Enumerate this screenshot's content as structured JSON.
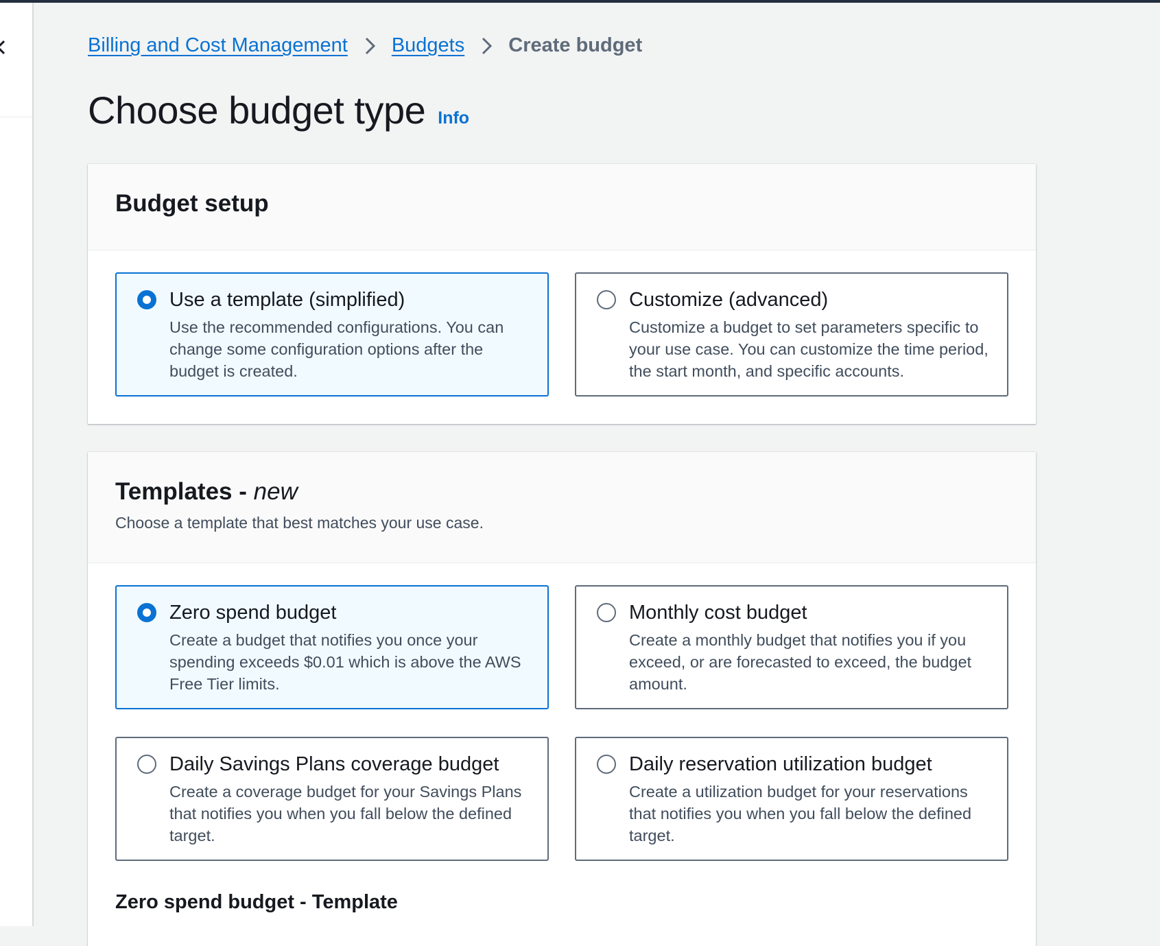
{
  "breadcrumb": {
    "items": [
      "Billing and Cost Management",
      "Budgets"
    ],
    "current": "Create budget"
  },
  "page": {
    "title": "Choose budget type",
    "info_label": "Info"
  },
  "budget_setup": {
    "title": "Budget setup",
    "options": [
      {
        "label": "Use a template (simplified)",
        "description": "Use the recommended configurations. You can change some configuration options after the budget is created.",
        "selected": true
      },
      {
        "label": "Customize (advanced)",
        "description": "Customize a budget to set parameters specific to your use case. You can customize the time period, the start month, and specific accounts.",
        "selected": false
      }
    ]
  },
  "templates": {
    "title": "Templates - ",
    "title_em": "new",
    "description": "Choose a template that best matches your use case.",
    "options": [
      {
        "label": "Zero spend budget",
        "description": "Create a budget that notifies you once your spending exceeds $0.01 which is above the AWS Free Tier limits.",
        "selected": true
      },
      {
        "label": "Monthly cost budget",
        "description": "Create a monthly budget that notifies you if you exceed, or are forecasted to exceed, the budget amount.",
        "selected": false
      },
      {
        "label": "Daily Savings Plans coverage budget",
        "description": "Create a coverage budget for your Savings Plans that notifies you when you fall below the defined target.",
        "selected": false
      },
      {
        "label": "Daily reservation utilization budget",
        "description": "Create a utilization budget for your reservations that notifies you when you fall below the defined target.",
        "selected": false
      }
    ],
    "selected_template_heading": "Zero spend budget - Template"
  },
  "colors": {
    "accent": "#0972d3",
    "selected_bg": "#f1faff",
    "page_bg": "#f2f3f3",
    "text": "#16191f",
    "muted_text": "#414d5c"
  }
}
